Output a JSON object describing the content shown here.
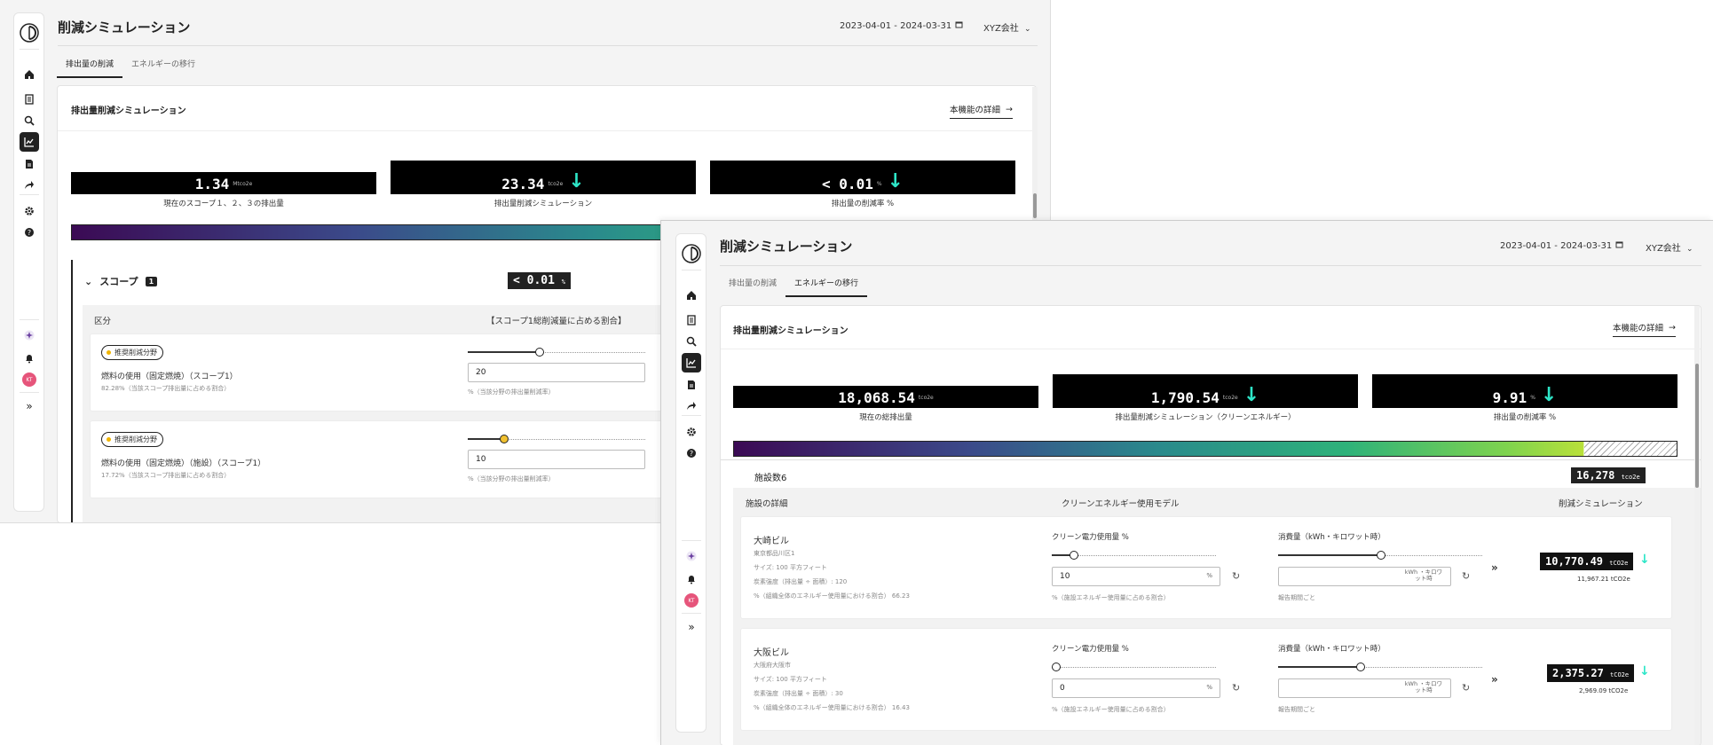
{
  "win1": {
    "page_title": "削減シミュレーション",
    "date_range": "2023-04-01 - 2024-03-31",
    "company": "XYZ会社",
    "tabs": [
      {
        "label": "排出量の削減",
        "active": true
      },
      {
        "label": "エネルギーの移行",
        "active": false
      }
    ],
    "card_title": "排出量削減シミュレーション",
    "detail_link": "本機能の詳細",
    "kpis": [
      {
        "value": "1.34",
        "unit": "Mtco2e",
        "label": "現在のスコープ１、２、３の排出量",
        "arrow": false
      },
      {
        "value": "23.34",
        "unit": "tco2e",
        "label": "排出量削減シミュレーション",
        "arrow": true
      },
      {
        "value": "< 0.01",
        "unit": "%",
        "label": "排出量の削減率 %",
        "arrow": true
      }
    ],
    "scope": {
      "label": "スコープ",
      "badge": "1",
      "value": "< 0.01",
      "unit": "%"
    },
    "section_header_left": "区分",
    "section_header_right": "【スコープ1総削減量に占める割合】",
    "rows": [
      {
        "pill": "推奨削減分野",
        "title": "燃料の使用（固定燃焼）（スコープ1）",
        "sub": "82.28%（当該スコープ排出量に占める割合）",
        "input_value": "20",
        "input_note": "%（当該分野の排出量削減率）",
        "slider": 0.4
      },
      {
        "pill": "推奨削減分野",
        "title": "燃料の使用（固定燃焼）（施設）（スコープ1）",
        "sub": "17.72%（当該スコープ排出量に占める割合）",
        "input_value": "10",
        "input_note": "%（当該分野の排出量削減率）",
        "slider": 0.2
      }
    ]
  },
  "win2": {
    "page_title": "削減シミュレーション",
    "date_range": "2023-04-01 - 2024-03-31",
    "company": "XYZ会社",
    "tabs": [
      {
        "label": "排出量の削減",
        "active": false
      },
      {
        "label": "エネルギーの移行",
        "active": true
      }
    ],
    "card_title": "排出量削減シミュレーション",
    "detail_link": "本機能の詳細",
    "kpis": [
      {
        "value": "18,068.54",
        "unit": "tco2e",
        "label": "現在の総排出量",
        "arrow": false
      },
      {
        "value": "1,790.54",
        "unit": "tco2e",
        "label": "排出量削減シミュレーション（クリーンエネルギー）",
        "arrow": true
      },
      {
        "value": "9.91",
        "unit": "%",
        "label": "排出量の削減率 %",
        "arrow": true
      }
    ],
    "facility_count_label": "施設数6",
    "facility_total": "16,278",
    "facility_total_unit": "tco2e",
    "section_headers": [
      "施設の詳細",
      "クリーンエネルギー使用モデル",
      "削減シミュレーション"
    ],
    "facilities": [
      {
        "name": "大崎ビル",
        "address": "東京都品川区1",
        "size": "サイズ: 100 平方フィート",
        "intensity": "炭素強度（排出量 ÷ 面積）: 120",
        "share": "%（組織全体のエネルギー使用量における割合） 66.23",
        "clean_label": "クリーン電力使用量 %",
        "clean_value": "10",
        "clean_suffix": "%",
        "clean_note": "%（施設エネルギー使用量に占める割合）",
        "clean_slider": 0.1,
        "consumption_label": "消費量（kWh・キロワット時）",
        "consumption_suffix": "kWh ・キロワット時",
        "consumption_note": "報告期間ごと",
        "consumption_slider": 0.5,
        "result": "10,770.49",
        "result_unit": "tCO2e",
        "result_sub": "11,967.21 tCO2e"
      },
      {
        "name": "大阪ビル",
        "address": "大阪府大阪市",
        "size": "サイズ: 100 平方フィート",
        "intensity": "炭素強度（排出量 ÷ 面積）: 30",
        "share": "%（組織全体のエネルギー使用量における割合） 16.43",
        "clean_label": "クリーン電力使用量 %",
        "clean_value": "0",
        "clean_suffix": "%",
        "clean_note": "%（施設エネルギー使用量に占める割合）",
        "clean_slider": 0.0,
        "consumption_label": "消費量（kWh・キロワット時）",
        "consumption_suffix": "kWh ・キロワット時",
        "consumption_note": "報告期間ごと",
        "consumption_slider": 0.4,
        "result": "2,375.27",
        "result_unit": "tCO2e",
        "result_sub": "2,969.09 tCO2e"
      }
    ]
  },
  "colors": {
    "accent_arrow": "#2ee6c8",
    "kpi_bg": "#000000",
    "avatar": "#e6557b",
    "pill_dot": "#f0b400"
  },
  "icons": [
    "logo-icon",
    "home-icon",
    "document-icon",
    "search-icon",
    "chart-icon",
    "report-icon",
    "share-icon",
    "settings-icon",
    "help-icon",
    "sparkle-icon",
    "bell-icon",
    "expand-icon",
    "calendar-icon",
    "chevron-down-icon",
    "arrow-right-icon",
    "refresh-icon",
    "double-chevron-right-icon",
    "down-arrow-icon"
  ],
  "avatar_initials": "KT"
}
